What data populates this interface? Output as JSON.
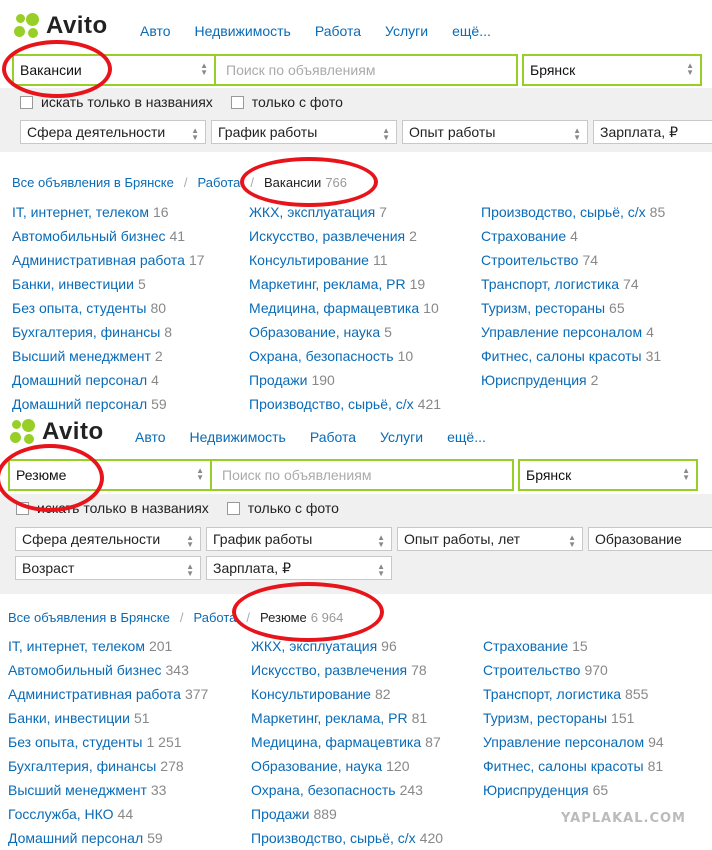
{
  "top": {
    "logo": "Avito",
    "nav": [
      "Авто",
      "Недвижимость",
      "Работа",
      "Услуги",
      "ещё..."
    ],
    "category": "Вакансии",
    "search_placeholder": "Поиск по объявлениям",
    "city": "Брянск",
    "checkbox_title": "искать только в названиях",
    "checkbox_photo": "только с фото",
    "filters": [
      "Сфера деятельности",
      "График работы",
      "Опыт работы",
      "Зарплата, ₽"
    ],
    "breadcrumb": {
      "all": "Все объявления в Брянске",
      "section": "Работа",
      "current": "Вакансии",
      "count": "766"
    },
    "columns": [
      [
        {
          "name": "IT, интернет, телеком",
          "count": "16"
        },
        {
          "name": "Автомобильный бизнес",
          "count": "41"
        },
        {
          "name": "Административная работа",
          "count": "17"
        },
        {
          "name": "Банки, инвестиции",
          "count": "5"
        },
        {
          "name": "Без опыта, студенты",
          "count": "80"
        },
        {
          "name": "Бухгалтерия, финансы",
          "count": "8"
        },
        {
          "name": "Высший менеджмент",
          "count": "2"
        },
        {
          "name": "Домашний персонал",
          "count": "4"
        },
        {
          "name": "Домашний персонал",
          "count": "59"
        }
      ],
      [
        {
          "name": "ЖКХ, эксплуатация",
          "count": "7"
        },
        {
          "name": "Искусство, развлечения",
          "count": "2"
        },
        {
          "name": "Консультирование",
          "count": "11"
        },
        {
          "name": "Маркетинг, реклама, PR",
          "count": "19"
        },
        {
          "name": "Медицина, фармацевтика",
          "count": "10"
        },
        {
          "name": "Образование, наука",
          "count": "5"
        },
        {
          "name": "Охрана, безопасность",
          "count": "10"
        },
        {
          "name": "Продажи",
          "count": "190"
        },
        {
          "name": "Производство, сырьё, с/х",
          "count": "421"
        }
      ],
      [
        {
          "name": "Производство, сырьё, с/х",
          "count": "85"
        },
        {
          "name": "Страхование",
          "count": "4"
        },
        {
          "name": "Строительство",
          "count": "74"
        },
        {
          "name": "Транспорт, логистика",
          "count": "74"
        },
        {
          "name": "Туризм, рестораны",
          "count": "65"
        },
        {
          "name": "Управление персоналом",
          "count": "4"
        },
        {
          "name": "Фитнес, салоны красоты",
          "count": "31"
        },
        {
          "name": "Юриспруденция",
          "count": "2"
        }
      ]
    ]
  },
  "bottom": {
    "logo": "Avito",
    "nav": [
      "Авто",
      "Недвижимость",
      "Работа",
      "Услуги",
      "ещё..."
    ],
    "category": "Резюме",
    "search_placeholder": "Поиск по объявлениям",
    "city": "Брянск",
    "checkbox_title": "искать только в названиях",
    "checkbox_photo": "только с фото",
    "filters": [
      "Сфера деятельности",
      "График работы",
      "Опыт работы, лет",
      "Образование",
      "Возраст",
      "Зарплата, ₽"
    ],
    "breadcrumb": {
      "all": "Все объявления в Брянске",
      "section": "Работа",
      "current": "Резюме",
      "count": "6 964"
    },
    "columns": [
      [
        {
          "name": "IT, интернет, телеком",
          "count": "201"
        },
        {
          "name": "Автомобильный бизнес",
          "count": "343"
        },
        {
          "name": "Административная работа",
          "count": "377"
        },
        {
          "name": "Банки, инвестиции",
          "count": "51"
        },
        {
          "name": "Без опыта, студенты",
          "count": "1 251"
        },
        {
          "name": "Бухгалтерия, финансы",
          "count": "278"
        },
        {
          "name": "Высший менеджмент",
          "count": "33"
        },
        {
          "name": "Госслужба, НКО",
          "count": "44"
        },
        {
          "name": "Домашний персонал",
          "count": "59"
        }
      ],
      [
        {
          "name": "ЖКХ, эксплуатация",
          "count": "96"
        },
        {
          "name": "Искусство, развлечения",
          "count": "78"
        },
        {
          "name": "Консультирование",
          "count": "82"
        },
        {
          "name": "Маркетинг, реклама, PR",
          "count": "81"
        },
        {
          "name": "Медицина, фармацевтика",
          "count": "87"
        },
        {
          "name": "Образование, наука",
          "count": "120"
        },
        {
          "name": "Охрана, безопасность",
          "count": "243"
        },
        {
          "name": "Продажи",
          "count": "889"
        },
        {
          "name": "Производство, сырьё, с/х",
          "count": "420"
        }
      ],
      [
        {
          "name": "Страхование",
          "count": "15"
        },
        {
          "name": "Строительство",
          "count": "970"
        },
        {
          "name": "Транспорт, логистика",
          "count": "855"
        },
        {
          "name": "Туризм, рестораны",
          "count": "151"
        },
        {
          "name": "Управление персоналом",
          "count": "94"
        },
        {
          "name": "Фитнес, салоны красоты",
          "count": "81"
        },
        {
          "name": "Юриспруденция",
          "count": "65"
        }
      ]
    ]
  },
  "watermark": "YAPLAKAL.COM",
  "colors": {
    "accent": "#97cf26",
    "link": "#0a6bb6",
    "annotation": "#e8141b"
  }
}
